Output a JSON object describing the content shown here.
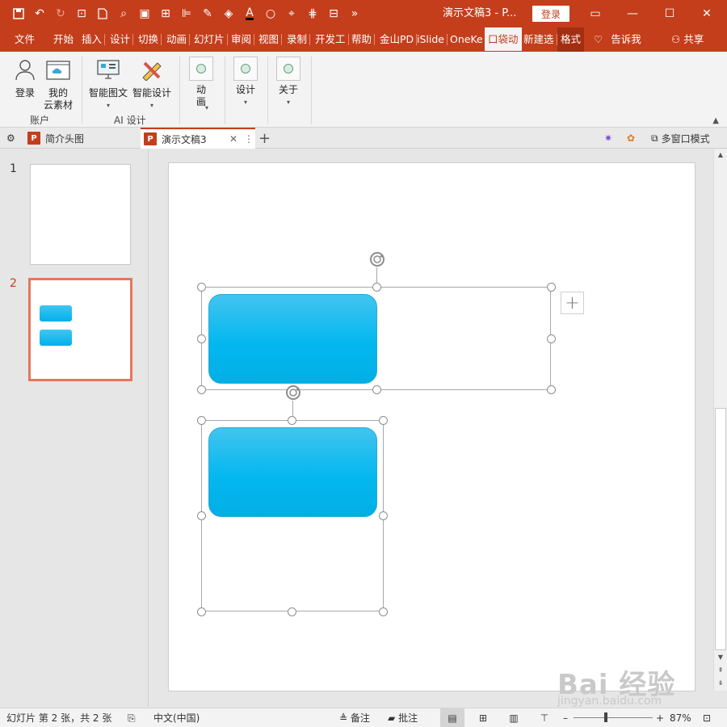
{
  "titlebar": {
    "doc_title": "演示文稿3 - P...",
    "login": "登录",
    "bg_color": "#c43e1c"
  },
  "tabs": {
    "file": "文件",
    "home": "开始",
    "insert": "插入",
    "design": "设计",
    "transitions": "切换",
    "animations": "动画",
    "slideshow": "幻灯片",
    "review": "审阅",
    "view": "视图",
    "record": "录制",
    "developer": "开发工",
    "help": "帮助",
    "jinshan": "金山PD",
    "islide": "iSlide",
    "onekey": "OneKe",
    "pocket": "口袋动",
    "newtab": "新建选",
    "format": "格式",
    "tell_me": "告诉我",
    "share": "共享"
  },
  "ribbon": {
    "login": "登录",
    "cloud_line1": "我的",
    "cloud_line2": "云素材",
    "group_account": "账户",
    "smart_graphic": "智能图文",
    "smart_design": "智能设计",
    "group_ai": "AI 设计",
    "anim_line1": "动",
    "anim_line2": "画",
    "design": "设计",
    "about": "关于"
  },
  "doc_tabs": {
    "tab1": "简介头图",
    "tab2": "演示文稿3",
    "multiwin": "多窗口模式"
  },
  "slides": {
    "num1": "1",
    "num2": "2"
  },
  "status": {
    "slide_info": "幻灯片 第 2 张，共 2 张",
    "language": "中文(中国)",
    "notes": "备注",
    "comments": "批注",
    "zoom": "87%"
  },
  "colors": {
    "accent": "#c43e1c",
    "shape_fill": "#03b8ef",
    "thumb_sel": "#e5775a"
  },
  "watermark": {
    "brand": "Bai 经验",
    "url": "jingyan.baidu.com"
  }
}
